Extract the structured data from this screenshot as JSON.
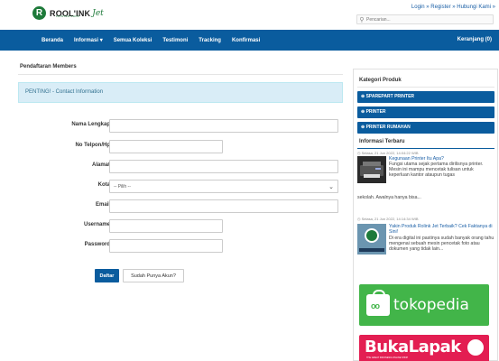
{
  "brand": {
    "logo_letter": "R",
    "logo_text": "ROOL'INK",
    "logo_jet": "Jet",
    "logo_sub": "PRINTER SHOP"
  },
  "top_links": {
    "login": "Login",
    "sep1": " » ",
    "register": "Register",
    "sep2": " » ",
    "contact": "Hubungi Kami",
    "sep3": " »"
  },
  "search": {
    "placeholder": "Pencarian..."
  },
  "nav": {
    "items": [
      "Beranda",
      "Informasi ▾",
      "Semua Koleksi",
      "Testimoni",
      "Tracking",
      "Konfirmasi"
    ],
    "cart": "Keranjang (0)"
  },
  "main": {
    "title": "Pendaftaran Members",
    "alert": "PENTING! - Contact Information",
    "fields": [
      {
        "label": "Nama Lengkap",
        "value": ""
      },
      {
        "label": "No Telpon/Hp",
        "value": ""
      },
      {
        "label": "Alamat",
        "value": ""
      },
      {
        "label": "Kota",
        "value": "-- Pilih --"
      },
      {
        "label": "Email",
        "value": ""
      },
      {
        "label": "Username",
        "value": ""
      },
      {
        "label": "Password",
        "value": ""
      }
    ],
    "submit": "Daftar",
    "have_account": "Sudah Punya Akun?"
  },
  "sidebar": {
    "cat_title": "Kategori Produk",
    "categories": [
      "⊕ SPAREPART PRINTER",
      "⊕ PRINTER",
      "⊕ PRINTER RUMAHAN"
    ],
    "info_title": "Informasi Terbaru",
    "news": [
      {
        "date": "◷ Selasa, 21 Jun 2022, 14:04:22 WIB",
        "title": "Kegunaan Printer Itu Apa?",
        "body": "Fungsi utama sejak pertama dirilisnya printer. Mesin ini mampu mencetak tulisan untuk keperluan kantor ataupun tugas",
        "tail": "sekolah. Awalnya hanya bisa...",
        "thumb": "printer photo"
      },
      {
        "date": "◷ Selasa, 21 Jun 2022, 14:14:34 WIB",
        "title": "Yakin Produk Rolink Jet Terbaik? Cek Faktanya di Sini!",
        "body": "Di era digital ini pastinya sudah banyak orang tahu mengenai sebuah mesin pencetak foto atau dokumen yang tidak lain...",
        "thumb_caption": "ROOL'INK Jet",
        "thumb": "logo banner"
      }
    ],
    "tokopedia": "tokopedia",
    "bukalapak": "BukaLapak",
    "bukalapak_sub": "THE GREAT INDONESIA ONLINE SHOP"
  },
  "colors": {
    "nav_blue": "#0a5c9e",
    "alert_bg": "#d9edf7",
    "tokopedia_green": "#42b549",
    "bukalapak_red": "#e31e52"
  }
}
